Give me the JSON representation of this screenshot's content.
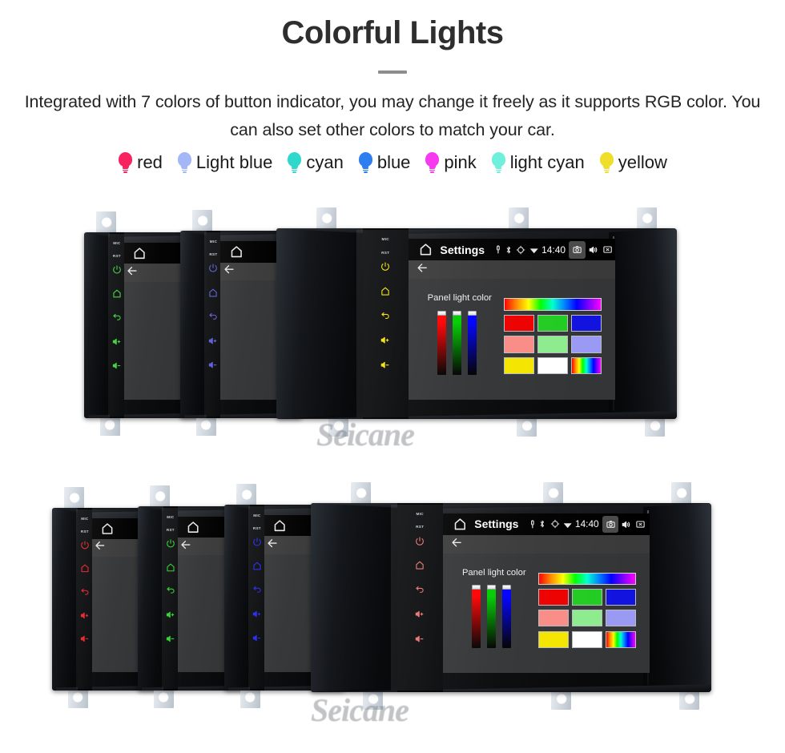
{
  "header": {
    "title": "Colorful Lights",
    "subtitle": "Integrated with 7 colors of button indicator, you may change it freely as it supports RGB color. You can also set other colors to match your car."
  },
  "legend": {
    "items": [
      {
        "label": "red",
        "color": "#f7245f"
      },
      {
        "label": "Light blue",
        "color": "#a3b6f7"
      },
      {
        "label": "cyan",
        "color": "#2fd8cd"
      },
      {
        "label": "blue",
        "color": "#2f7ef0"
      },
      {
        "label": "pink",
        "color": "#f73af0"
      },
      {
        "label": "light cyan",
        "color": "#6ef0dc"
      },
      {
        "label": "yellow",
        "color": "#efdf2a"
      }
    ]
  },
  "unit_ui": {
    "side_labels": {
      "mic": "MIC",
      "rst": "RST"
    },
    "side_buttons": [
      "power-icon",
      "home-icon",
      "back-icon",
      "volume-up-icon",
      "volume-down-icon"
    ],
    "statusbar": {
      "home_icon": "home-icon",
      "title": "Settings",
      "mic_icon": "mic-icon",
      "bluetooth_icon": "bluetooth-icon",
      "location_icon": "location-icon",
      "wifi_icon": "wifi-icon",
      "clock": "14:40",
      "camera_icon": "camera-icon",
      "volume_icon": "volume-icon",
      "close_icon": "close-icon",
      "recents_icon": "recents-icon",
      "back_icon": "back-arrow-icon"
    },
    "actionbar": {
      "back_icon": "back-arrow-icon"
    },
    "dialog": {
      "title": "Panel light color",
      "sliders": [
        {
          "name": "red-slider",
          "color": "#ff0000"
        },
        {
          "name": "green-slider",
          "color": "#00cc00"
        },
        {
          "name": "blue-slider",
          "color": "#0000ff"
        }
      ],
      "swatches": [
        {
          "name": "rainbow-swatch",
          "color": "rainbow"
        },
        {
          "name": "red-swatch",
          "color": "#ee0000"
        },
        {
          "name": "green-swatch",
          "color": "#22cc22"
        },
        {
          "name": "blue-swatch",
          "color": "#1313e0"
        },
        {
          "name": "light-red-swatch",
          "color": "#f98c86"
        },
        {
          "name": "light-green-swatch",
          "color": "#8eeb8e"
        },
        {
          "name": "light-blue-swatch",
          "color": "#9a9af5"
        },
        {
          "name": "yellow-swatch",
          "color": "#f5e500"
        },
        {
          "name": "white-swatch",
          "color": "#ffffff"
        },
        {
          "name": "rainbow-small-swatch",
          "color": "rainbow"
        }
      ]
    }
  },
  "groups": {
    "top": {
      "watermark": "Seicane",
      "units": [
        {
          "name": "unit-green",
          "led_color": "#3cd13c"
        },
        {
          "name": "unit-indigo",
          "led_color": "#5b5bd6"
        },
        {
          "name": "unit-yellow",
          "led_color": "#f2e00c"
        }
      ]
    },
    "bottom": {
      "watermark": "Seicane",
      "units": [
        {
          "name": "unit-red",
          "led_color": "#e8202a"
        },
        {
          "name": "unit-green",
          "led_color": "#2ad42a"
        },
        {
          "name": "unit-blue",
          "led_color": "#2424ee"
        },
        {
          "name": "unit-salmon",
          "led_color": "#e9736f"
        }
      ]
    }
  }
}
